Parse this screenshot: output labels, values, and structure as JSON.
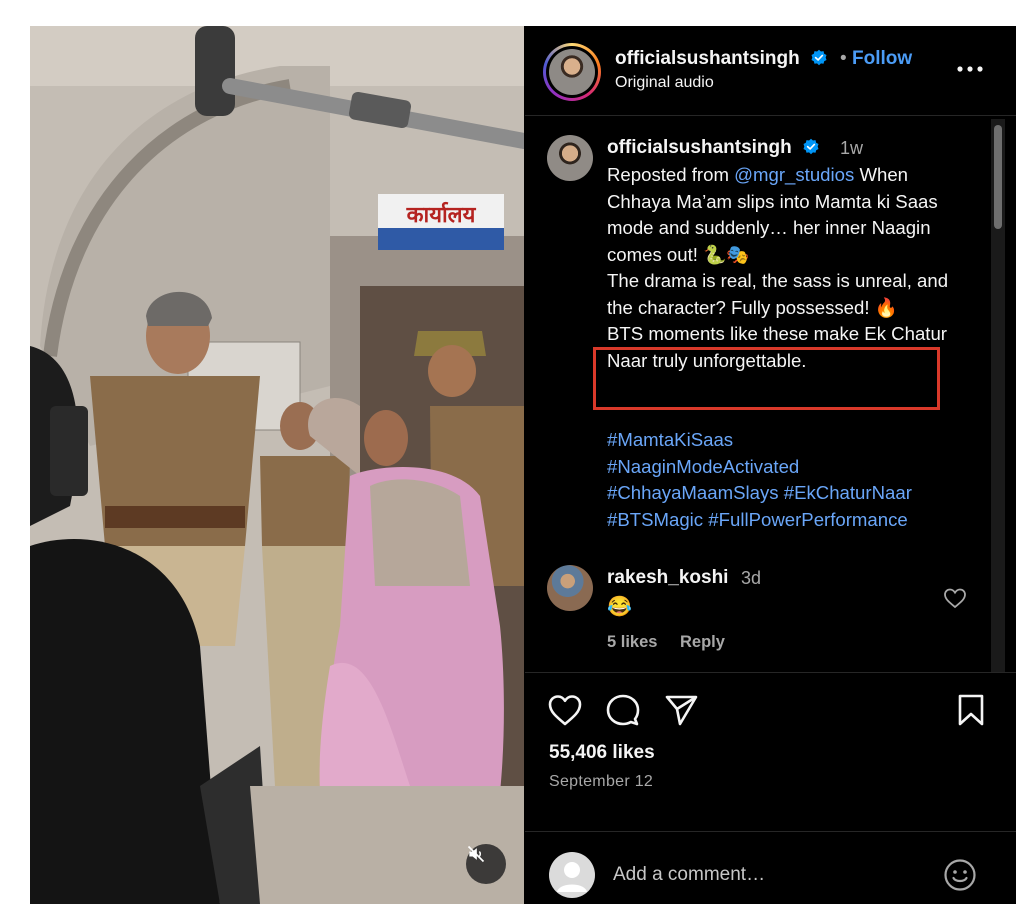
{
  "header": {
    "username": "officialsushantsingh",
    "separator": "•",
    "follow_label": "Follow",
    "audio_label": "Original audio"
  },
  "caption": {
    "username": "officialsushantsingh",
    "time": "1w",
    "repost_prefix": "Reposted from",
    "mention": "@mgr_studios",
    "text_1": " When Chhaya Ma’am slips into Mamta ki Saas mode and suddenly… her inner Naagin comes out! 🐍🎭",
    "text_2": "The drama is real, the sass is unreal, and the character? Fully possessed! 🔥",
    "highlighted_text": "BTS moments like these make Ek Chatur Naar truly unforgettable.",
    "hashtags": [
      "#MamtaKiSaas",
      "#NaaginModeActivated",
      "#ChhayaMaamSlays",
      "#EkChaturNaar",
      "#BTSMagic",
      "#FullPowerPerformance"
    ]
  },
  "comment": {
    "username": "rakesh_koshi",
    "time": "3d",
    "text": "😂",
    "likes": "5 likes",
    "reply_label": "Reply"
  },
  "post": {
    "likes": "55,406 likes",
    "date": "September 12"
  },
  "add_comment": {
    "placeholder": "Add a comment…"
  },
  "video": {
    "sign_text": "कार्यालय"
  },
  "colors": {
    "link": "#4b9cf6",
    "highlight_border": "#d9392a",
    "hashtag": "#6aa6f8"
  }
}
